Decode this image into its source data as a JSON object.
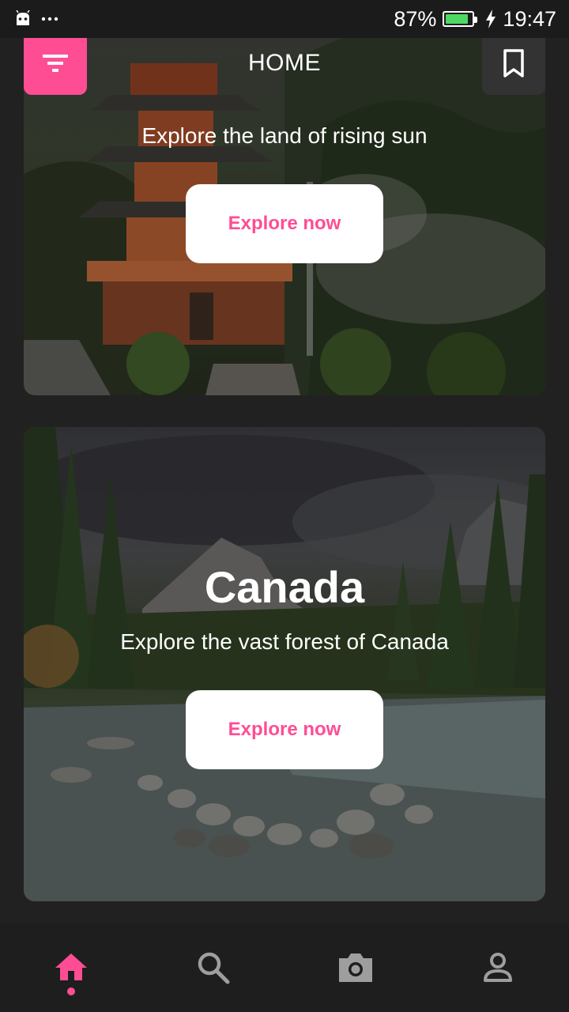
{
  "status_bar": {
    "battery_percent": "87%",
    "battery_level": 0.87,
    "time": "19:47",
    "left_icons": [
      "android-icon",
      "more-dots-icon"
    ]
  },
  "app_bar": {
    "title": "HOME",
    "left_icon": "filter-icon",
    "right_icon": "bookmark-icon"
  },
  "cards": [
    {
      "title": "",
      "subtitle": "Explore the land of rising sun",
      "button_label": "Explore now"
    },
    {
      "title": "Canada",
      "subtitle": "Explore the vast forest of Canada",
      "button_label": "Explore now"
    }
  ],
  "bottom_nav": {
    "items": [
      {
        "icon": "home-icon",
        "active": true
      },
      {
        "icon": "search-icon",
        "active": false
      },
      {
        "icon": "camera-icon",
        "active": false
      },
      {
        "icon": "profile-icon",
        "active": false
      }
    ]
  },
  "colors": {
    "accent": "#ff4d94",
    "background": "#212121",
    "nav_inactive": "#9e9e9e",
    "battery_fill": "#4cd964"
  }
}
